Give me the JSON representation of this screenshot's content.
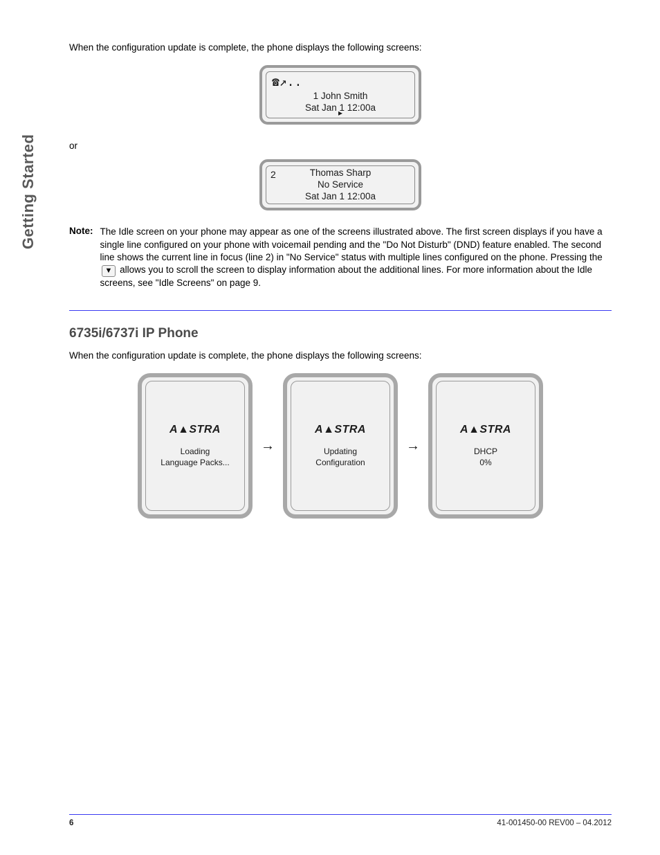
{
  "sidebar_label": "Getting Started",
  "para1": "When the configuration update is complete, the phone displays the following screens:",
  "lcd1": {
    "icons": "☎↗..",
    "line1": "1 John Smith",
    "datetime": "Sat Jan 1 12:00a",
    "arrow": "▸"
  },
  "para2": "or",
  "lcd2": {
    "linenum": "2",
    "name": "Thomas Sharp",
    "status": "No Service",
    "datetime": "Sat Jan 1 12:00a"
  },
  "note_label": "Note:",
  "note_text_1": "The Idle screen on your phone may appear as one of the screens illustrated above. The first screen displays if you have a single line configured on your phone with voicemail pending and the \"Do Not Disturb\" (DND) feature enabled. The second line shows the current line in focus (line 2) in \"No Service\" status with multiple lines configured on the phone. Pressing the ",
  "down_key": "▼",
  "note_text_2": " allows you to scroll the screen to display information about the additional lines. For more information about the Idle screens, see \"Idle Screens\" on page 9.",
  "model_heading": "6735i/6737i IP Phone",
  "para3": "When the configuration update is complete, the phone displays the following screens:",
  "phones": {
    "brand": "A▲STRA",
    "screen1": {
      "l1": "Loading",
      "l2": "Language Packs..."
    },
    "screen2": {
      "l1": "Updating",
      "l2": "Configuration"
    },
    "screen3": {
      "l1": "DHCP",
      "l2": "0%"
    },
    "arrow": "→"
  },
  "footer": {
    "page": "6",
    "doc": "41-001450-00 REV00 – 04.2012"
  }
}
